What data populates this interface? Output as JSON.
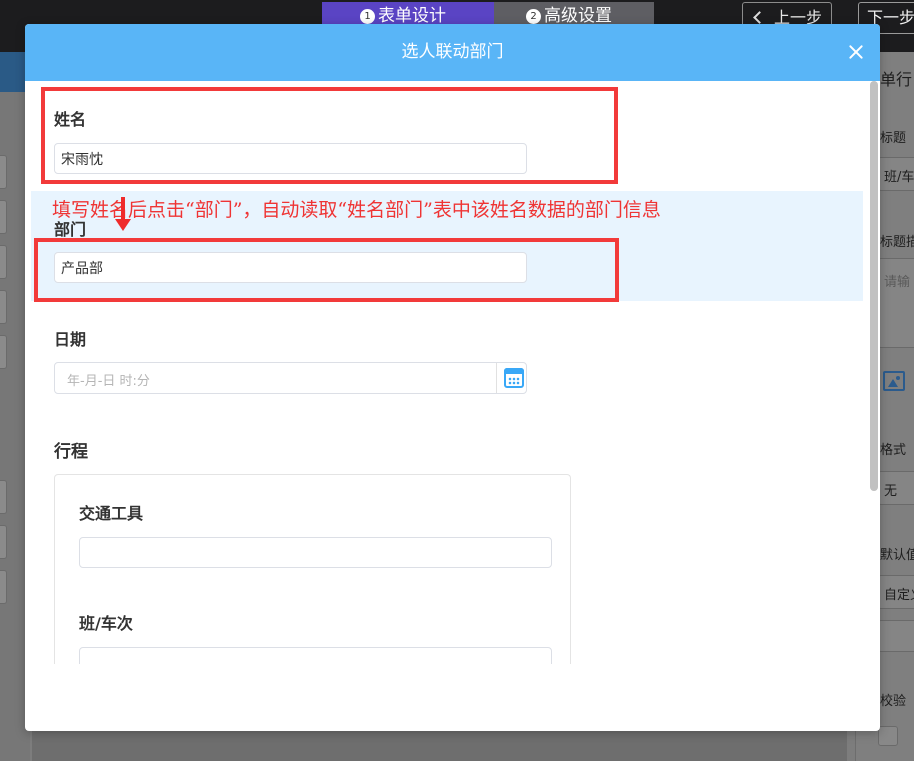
{
  "topbar": {
    "steps": [
      {
        "num": "1",
        "label": "表单设计",
        "active": true
      },
      {
        "num": "2",
        "label": "高级设置",
        "active": false
      }
    ],
    "prev_label": "上一步",
    "next_label": "下一步"
  },
  "right_panel": {
    "title": "单行",
    "field_title_label": "标题",
    "field_title_value": "班/车",
    "field_desc_label": "标题描",
    "field_desc_placeholder": "请输",
    "format_label": "格式",
    "format_value": "无",
    "default_label": "默认值",
    "default_value": "自定义",
    "validate_label": "校验"
  },
  "modal": {
    "title": "选人联动部门",
    "name_label": "姓名",
    "name_value": "宋雨忱",
    "dept_label": "部门",
    "dept_value": "产品部",
    "date_label": "日期",
    "date_placeholder": "年-月-日 时:分",
    "trip_title": "行程",
    "transport_label": "交通工具",
    "transport_value": "",
    "train_label": "班/车次",
    "train_value": ""
  },
  "annotation": {
    "text": "填写姓名后点击“部门”，自动读取“姓名部门”表中该姓名数据的部门信息",
    "color": "#ef3434"
  },
  "colors": {
    "header": "#59b5f7",
    "step_active": "#5a44c4",
    "highlight": "#e8f4fe",
    "accent": "#39a8f7"
  }
}
